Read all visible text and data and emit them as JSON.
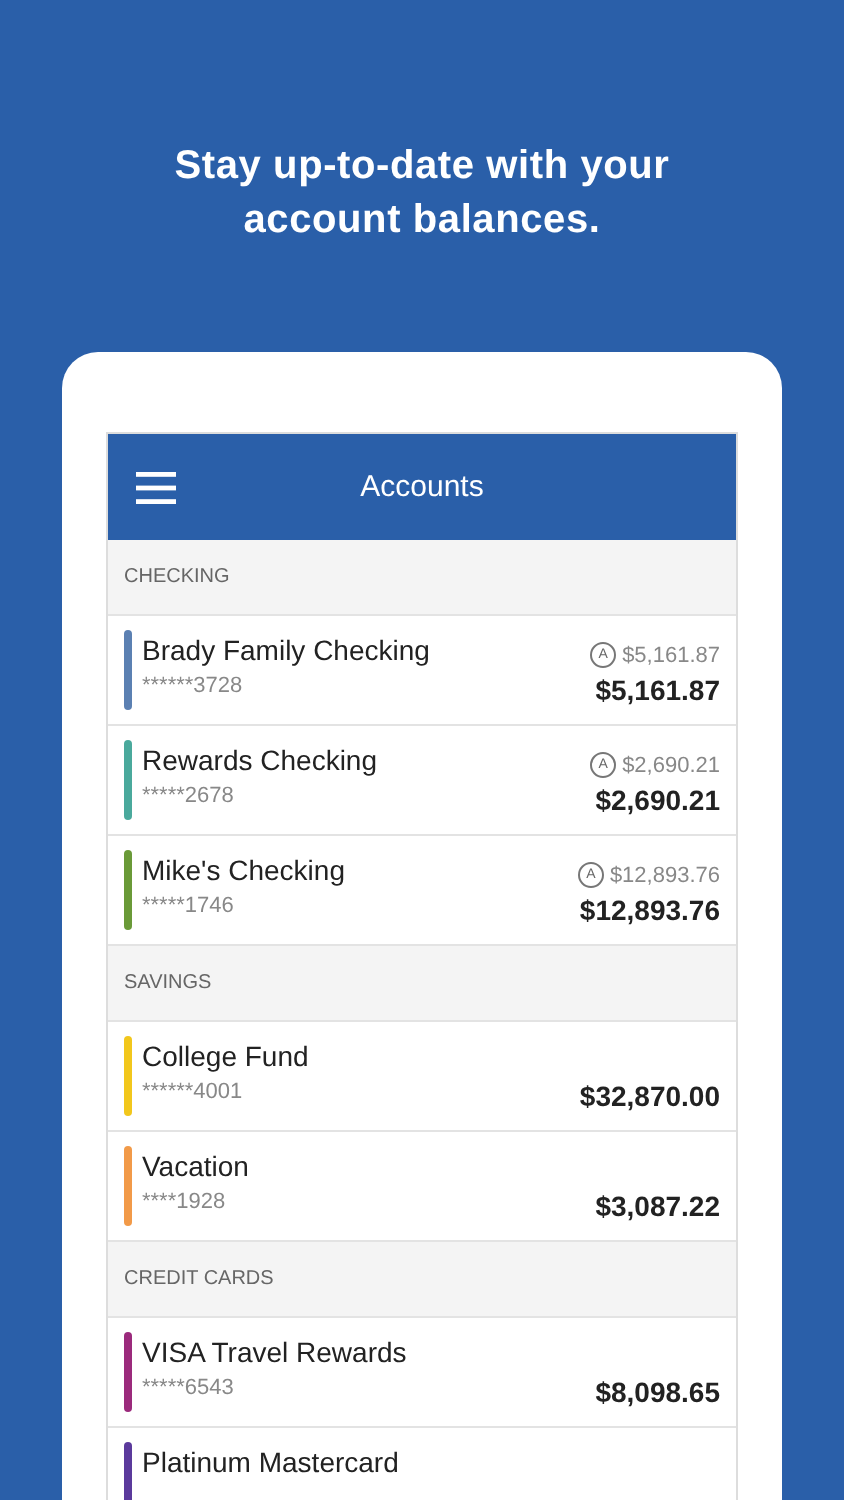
{
  "headline": "Stay up-to-date with your account balances.",
  "app_bar": {
    "title": "Accounts"
  },
  "sections": [
    {
      "title": "CHECKING",
      "accounts": [
        {
          "name": "Brady Family Checking",
          "number": "******3728",
          "color": "#5b80b2",
          "badge": "A",
          "available": "$5,161.87",
          "balance": "$5,161.87"
        },
        {
          "name": "Rewards Checking",
          "number": "*****2678",
          "color": "#4aa99c",
          "badge": "A",
          "available": "$2,690.21",
          "balance": "$2,690.21"
        },
        {
          "name": "Mike's Checking",
          "number": "*****1746",
          "color": "#6a9a38",
          "badge": "A",
          "available": "$12,893.76",
          "balance": "$12,893.76"
        }
      ]
    },
    {
      "title": "SAVINGS",
      "accounts": [
        {
          "name": "College Fund",
          "number": "******4001",
          "color": "#f2c71c",
          "balance": "$32,870.00"
        },
        {
          "name": "Vacation",
          "number": "****1928",
          "color": "#f29a48",
          "balance": "$3,087.22"
        }
      ]
    },
    {
      "title": "CREDIT CARDS",
      "accounts": [
        {
          "name": "VISA Travel Rewards",
          "number": "*****6543",
          "color": "#9b2a7c",
          "balance": "$8,098.65"
        },
        {
          "name": "Platinum Mastercard",
          "color": "#5b3a9c"
        }
      ]
    }
  ]
}
